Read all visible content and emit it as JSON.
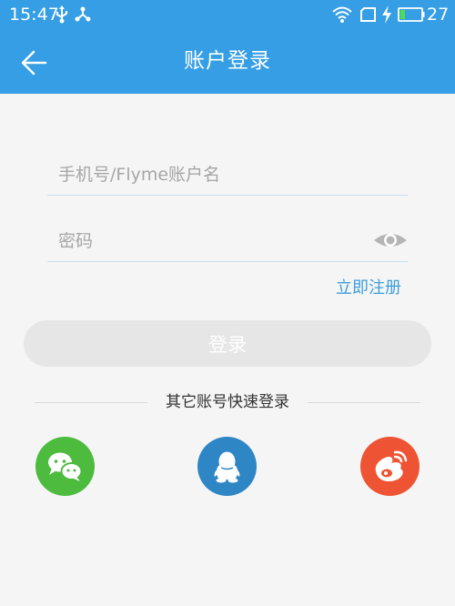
{
  "status_bar": {
    "time": "15:47",
    "battery_level": "27",
    "icons": [
      "usb-icon",
      "share-icon",
      "wifi-icon",
      "sim-icon",
      "charging-icon",
      "battery-icon"
    ]
  },
  "header": {
    "title": "账户登录",
    "back_icon": "arrow-left-icon",
    "background_color": "#359ee4"
  },
  "form": {
    "username_placeholder": "手机号/Flyme账户名",
    "username_value": "",
    "password_placeholder": "密码",
    "password_value": "",
    "password_toggle_icon": "eye-icon",
    "register_label": "立即注册",
    "login_label": "登录"
  },
  "quick_login": {
    "label": "其它账号快速登录",
    "providers": [
      {
        "icon": "wechat-icon",
        "color": "#4cbb3e"
      },
      {
        "icon": "qq-icon",
        "color": "#2e86c5"
      },
      {
        "icon": "weibo-icon",
        "color": "#ee5433"
      }
    ]
  }
}
